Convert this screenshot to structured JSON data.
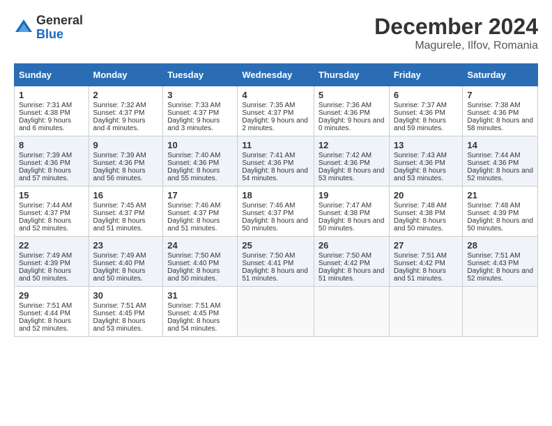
{
  "logo": {
    "general": "General",
    "blue": "Blue"
  },
  "title": {
    "month_year": "December 2024",
    "location": "Magurele, Ilfov, Romania"
  },
  "headers": [
    "Sunday",
    "Monday",
    "Tuesday",
    "Wednesday",
    "Thursday",
    "Friday",
    "Saturday"
  ],
  "weeks": [
    [
      {
        "day": "1",
        "sunrise": "Sunrise: 7:31 AM",
        "sunset": "Sunset: 4:38 PM",
        "daylight": "Daylight: 9 hours and 6 minutes."
      },
      {
        "day": "2",
        "sunrise": "Sunrise: 7:32 AM",
        "sunset": "Sunset: 4:37 PM",
        "daylight": "Daylight: 9 hours and 4 minutes."
      },
      {
        "day": "3",
        "sunrise": "Sunrise: 7:33 AM",
        "sunset": "Sunset: 4:37 PM",
        "daylight": "Daylight: 9 hours and 3 minutes."
      },
      {
        "day": "4",
        "sunrise": "Sunrise: 7:35 AM",
        "sunset": "Sunset: 4:37 PM",
        "daylight": "Daylight: 9 hours and 2 minutes."
      },
      {
        "day": "5",
        "sunrise": "Sunrise: 7:36 AM",
        "sunset": "Sunset: 4:36 PM",
        "daylight": "Daylight: 9 hours and 0 minutes."
      },
      {
        "day": "6",
        "sunrise": "Sunrise: 7:37 AM",
        "sunset": "Sunset: 4:36 PM",
        "daylight": "Daylight: 8 hours and 59 minutes."
      },
      {
        "day": "7",
        "sunrise": "Sunrise: 7:38 AM",
        "sunset": "Sunset: 4:36 PM",
        "daylight": "Daylight: 8 hours and 58 minutes."
      }
    ],
    [
      {
        "day": "8",
        "sunrise": "Sunrise: 7:39 AM",
        "sunset": "Sunset: 4:36 PM",
        "daylight": "Daylight: 8 hours and 57 minutes."
      },
      {
        "day": "9",
        "sunrise": "Sunrise: 7:39 AM",
        "sunset": "Sunset: 4:36 PM",
        "daylight": "Daylight: 8 hours and 56 minutes."
      },
      {
        "day": "10",
        "sunrise": "Sunrise: 7:40 AM",
        "sunset": "Sunset: 4:36 PM",
        "daylight": "Daylight: 8 hours and 55 minutes."
      },
      {
        "day": "11",
        "sunrise": "Sunrise: 7:41 AM",
        "sunset": "Sunset: 4:36 PM",
        "daylight": "Daylight: 8 hours and 54 minutes."
      },
      {
        "day": "12",
        "sunrise": "Sunrise: 7:42 AM",
        "sunset": "Sunset: 4:36 PM",
        "daylight": "Daylight: 8 hours and 53 minutes."
      },
      {
        "day": "13",
        "sunrise": "Sunrise: 7:43 AM",
        "sunset": "Sunset: 4:36 PM",
        "daylight": "Daylight: 8 hours and 53 minutes."
      },
      {
        "day": "14",
        "sunrise": "Sunrise: 7:44 AM",
        "sunset": "Sunset: 4:36 PM",
        "daylight": "Daylight: 8 hours and 52 minutes."
      }
    ],
    [
      {
        "day": "15",
        "sunrise": "Sunrise: 7:44 AM",
        "sunset": "Sunset: 4:37 PM",
        "daylight": "Daylight: 8 hours and 52 minutes."
      },
      {
        "day": "16",
        "sunrise": "Sunrise: 7:45 AM",
        "sunset": "Sunset: 4:37 PM",
        "daylight": "Daylight: 8 hours and 51 minutes."
      },
      {
        "day": "17",
        "sunrise": "Sunrise: 7:46 AM",
        "sunset": "Sunset: 4:37 PM",
        "daylight": "Daylight: 8 hours and 51 minutes."
      },
      {
        "day": "18",
        "sunrise": "Sunrise: 7:46 AM",
        "sunset": "Sunset: 4:37 PM",
        "daylight": "Daylight: 8 hours and 50 minutes."
      },
      {
        "day": "19",
        "sunrise": "Sunrise: 7:47 AM",
        "sunset": "Sunset: 4:38 PM",
        "daylight": "Daylight: 8 hours and 50 minutes."
      },
      {
        "day": "20",
        "sunrise": "Sunrise: 7:48 AM",
        "sunset": "Sunset: 4:38 PM",
        "daylight": "Daylight: 8 hours and 50 minutes."
      },
      {
        "day": "21",
        "sunrise": "Sunrise: 7:48 AM",
        "sunset": "Sunset: 4:39 PM",
        "daylight": "Daylight: 8 hours and 50 minutes."
      }
    ],
    [
      {
        "day": "22",
        "sunrise": "Sunrise: 7:49 AM",
        "sunset": "Sunset: 4:39 PM",
        "daylight": "Daylight: 8 hours and 50 minutes."
      },
      {
        "day": "23",
        "sunrise": "Sunrise: 7:49 AM",
        "sunset": "Sunset: 4:40 PM",
        "daylight": "Daylight: 8 hours and 50 minutes."
      },
      {
        "day": "24",
        "sunrise": "Sunrise: 7:50 AM",
        "sunset": "Sunset: 4:40 PM",
        "daylight": "Daylight: 8 hours and 50 minutes."
      },
      {
        "day": "25",
        "sunrise": "Sunrise: 7:50 AM",
        "sunset": "Sunset: 4:41 PM",
        "daylight": "Daylight: 8 hours and 51 minutes."
      },
      {
        "day": "26",
        "sunrise": "Sunrise: 7:50 AM",
        "sunset": "Sunset: 4:42 PM",
        "daylight": "Daylight: 8 hours and 51 minutes."
      },
      {
        "day": "27",
        "sunrise": "Sunrise: 7:51 AM",
        "sunset": "Sunset: 4:42 PM",
        "daylight": "Daylight: 8 hours and 51 minutes."
      },
      {
        "day": "28",
        "sunrise": "Sunrise: 7:51 AM",
        "sunset": "Sunset: 4:43 PM",
        "daylight": "Daylight: 8 hours and 52 minutes."
      }
    ],
    [
      {
        "day": "29",
        "sunrise": "Sunrise: 7:51 AM",
        "sunset": "Sunset: 4:44 PM",
        "daylight": "Daylight: 8 hours and 52 minutes."
      },
      {
        "day": "30",
        "sunrise": "Sunrise: 7:51 AM",
        "sunset": "Sunset: 4:45 PM",
        "daylight": "Daylight: 8 hours and 53 minutes."
      },
      {
        "day": "31",
        "sunrise": "Sunrise: 7:51 AM",
        "sunset": "Sunset: 4:45 PM",
        "daylight": "Daylight: 8 hours and 54 minutes."
      },
      null,
      null,
      null,
      null
    ]
  ]
}
